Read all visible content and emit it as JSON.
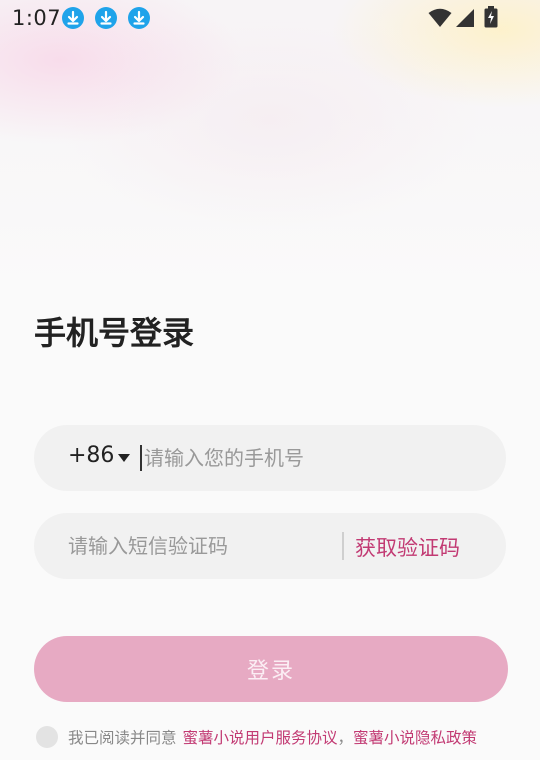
{
  "status_bar": {
    "time": "1:07",
    "notification_icons": [
      "download-icon",
      "download-icon",
      "download-icon"
    ],
    "system_icons": [
      "wifi-icon",
      "cellular-signal-icon",
      "battery-charging-icon"
    ]
  },
  "colors": {
    "accent": "#c23a73",
    "button_disabled": "#e7aac3",
    "field_bg": "#f1f1f1",
    "download_icon": "#1fa3ea"
  },
  "login": {
    "title": "手机号登录",
    "country_code": "+86",
    "phone_placeholder": "请输入您的手机号",
    "phone_value": "",
    "code_placeholder": "请输入短信验证码",
    "code_value": "",
    "get_code_label": "获取验证码",
    "login_button_label": "登录"
  },
  "agreement": {
    "prefix": "我已阅读并同意",
    "service_link": "蜜薯小说用户服务协议",
    "separator": "，",
    "privacy_link": "蜜薯小说隐私政策"
  }
}
